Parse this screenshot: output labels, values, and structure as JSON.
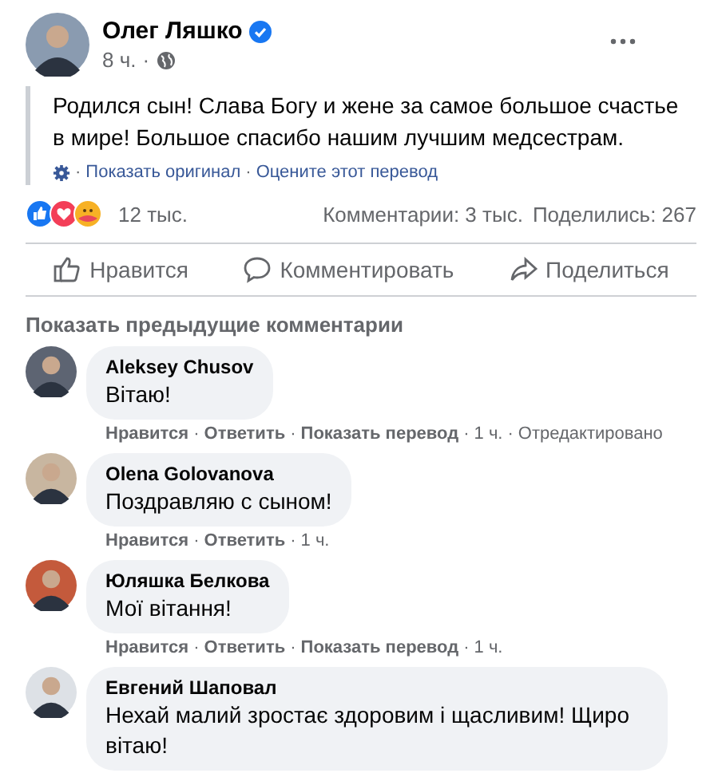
{
  "post": {
    "author": "Олег Ляшко",
    "verified": true,
    "time": "8 ч.",
    "text": "Родился сын! Слава Богу и жене за самое большое счастье в мире! Большое спасибо нашим лучшим медсестрам.",
    "translation_links": [
      "Показать оригинал",
      "Оцените этот перевод"
    ]
  },
  "stats": {
    "reactions": "12 тыс.",
    "comments": "Комментарии: 3 тыс.",
    "shares": "Поделились: 267"
  },
  "actions": [
    {
      "kind": "like",
      "label": "Нравится"
    },
    {
      "kind": "comment",
      "label": "Комментировать"
    },
    {
      "kind": "share",
      "label": "Поделиться"
    }
  ],
  "previous_comments": "Показать предыдущие комментарии",
  "separator": "·",
  "comments": [
    {
      "author": "Aleksey Chusov",
      "text": "Вітаю!",
      "actions": [
        {
          "kind": "link",
          "label": "Нравится"
        },
        {
          "kind": "link",
          "label": "Ответить"
        },
        {
          "kind": "link",
          "label": "Показать перевод"
        },
        {
          "kind": "meta",
          "label": "1 ч."
        },
        {
          "kind": "meta",
          "label": "Отредактировано"
        }
      ]
    },
    {
      "author": "Olena Golovanova",
      "text": "Поздравляю с сыном!",
      "actions": [
        {
          "kind": "link",
          "label": "Нравится"
        },
        {
          "kind": "link",
          "label": "Ответить"
        },
        {
          "kind": "meta",
          "label": "1 ч."
        }
      ]
    },
    {
      "author": "Юляшка Белкова",
      "text": "Мої вітання!",
      "actions": [
        {
          "kind": "link",
          "label": "Нравится"
        },
        {
          "kind": "link",
          "label": "Ответить"
        },
        {
          "kind": "link",
          "label": "Показать перевод"
        },
        {
          "kind": "meta",
          "label": "1 ч."
        }
      ]
    },
    {
      "author": "Евгений Шаповал",
      "text": "Нехай малий зростає здоровим і щасливим! Щиро вітаю!"
    }
  ]
}
